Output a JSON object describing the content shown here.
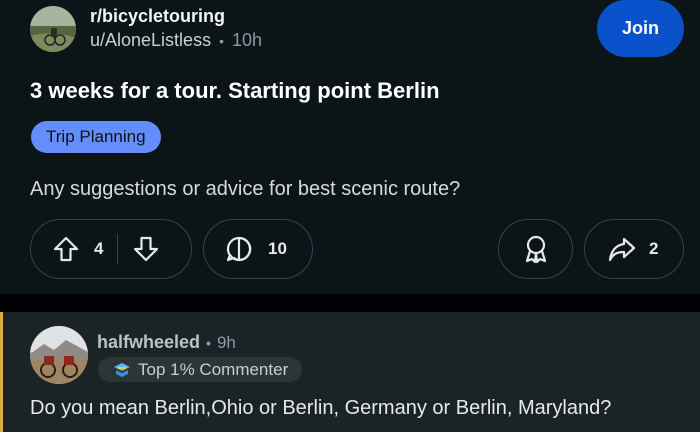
{
  "post": {
    "subreddit": "r/bicycletouring",
    "author": "u/AloneListless",
    "separator": "•",
    "time": "10h",
    "join_label": "Join",
    "title": "3 weeks for a tour. Starting point Berlin",
    "flair": "Trip Planning",
    "body": "Any suggestions or advice for best scenic route?",
    "votes": "4",
    "comments": "10",
    "shares": "2"
  },
  "comment": {
    "username": "halfwheeled",
    "separator": "•",
    "time": "9h",
    "badge": "Top 1% Commenter",
    "text": "Do you mean Berlin,Ohio or Berlin, Germany or Berlin, Maryland?"
  },
  "colors": {
    "background": "#0b1416",
    "join_button": "#0a52cc",
    "flair": "#648efc",
    "comment_bg": "#1a2325",
    "comment_accent": "#d6b13a"
  },
  "icons": [
    "upvote-icon",
    "downvote-icon",
    "comment-icon",
    "award-icon",
    "share-icon",
    "commenter-badge-icon"
  ]
}
